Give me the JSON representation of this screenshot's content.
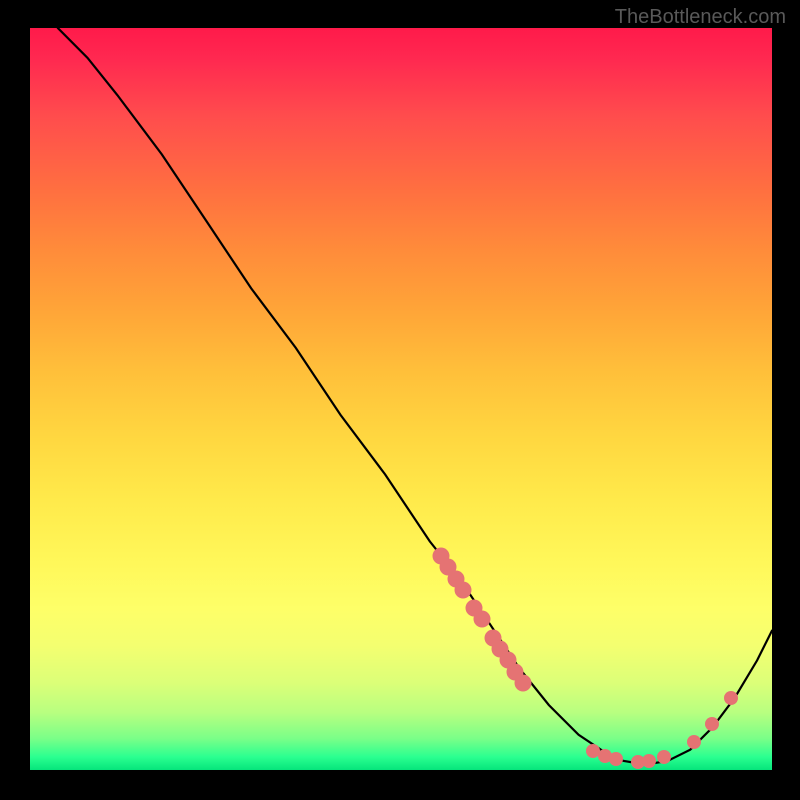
{
  "watermark": "TheBottleneck.com",
  "chart_data": {
    "type": "line",
    "title": "",
    "xlabel": "",
    "ylabel": "",
    "xlim": [
      0,
      100
    ],
    "ylim": [
      0,
      100
    ],
    "grid": false,
    "legend": false,
    "series": [
      {
        "name": "bottleneck-curve",
        "x": [
          4,
          8,
          12,
          18,
          24,
          30,
          36,
          42,
          48,
          54,
          58,
          62,
          66,
          70,
          74,
          77,
          80,
          83,
          86,
          89,
          92,
          95,
          98,
          100
        ],
        "y": [
          100,
          96,
          91,
          83,
          74,
          65,
          57,
          48,
          40,
          31,
          26,
          20,
          14,
          9,
          5,
          3,
          1.5,
          1,
          1.5,
          3,
          6,
          10,
          15,
          19
        ]
      }
    ],
    "marker_clusters": [
      {
        "name": "left-descent-cluster",
        "points": [
          {
            "x": 55.5,
            "y": 29
          },
          {
            "x": 56.5,
            "y": 27.5
          },
          {
            "x": 57.5,
            "y": 26
          },
          {
            "x": 58.5,
            "y": 24.5
          },
          {
            "x": 60.0,
            "y": 22
          },
          {
            "x": 61.0,
            "y": 20.5
          },
          {
            "x": 62.5,
            "y": 18
          },
          {
            "x": 63.5,
            "y": 16.5
          },
          {
            "x": 64.5,
            "y": 15
          },
          {
            "x": 65.5,
            "y": 13.5
          },
          {
            "x": 66.5,
            "y": 12
          }
        ]
      },
      {
        "name": "valley-cluster",
        "points": [
          {
            "x": 76.0,
            "y": 2.8
          },
          {
            "x": 77.5,
            "y": 2.2
          },
          {
            "x": 79.0,
            "y": 1.8
          },
          {
            "x": 82.0,
            "y": 1.4
          },
          {
            "x": 83.5,
            "y": 1.5
          },
          {
            "x": 85.5,
            "y": 2.0
          }
        ]
      },
      {
        "name": "right-ascent-cluster",
        "points": [
          {
            "x": 89.5,
            "y": 4.0
          },
          {
            "x": 92.0,
            "y": 6.5
          },
          {
            "x": 94.5,
            "y": 10.0
          }
        ]
      }
    ],
    "colors": {
      "curve": "#000000",
      "marker": "#e57373",
      "gradient_top": "#ff1a4a",
      "gradient_mid": "#ffe94a",
      "gradient_bottom": "#00e078"
    }
  }
}
